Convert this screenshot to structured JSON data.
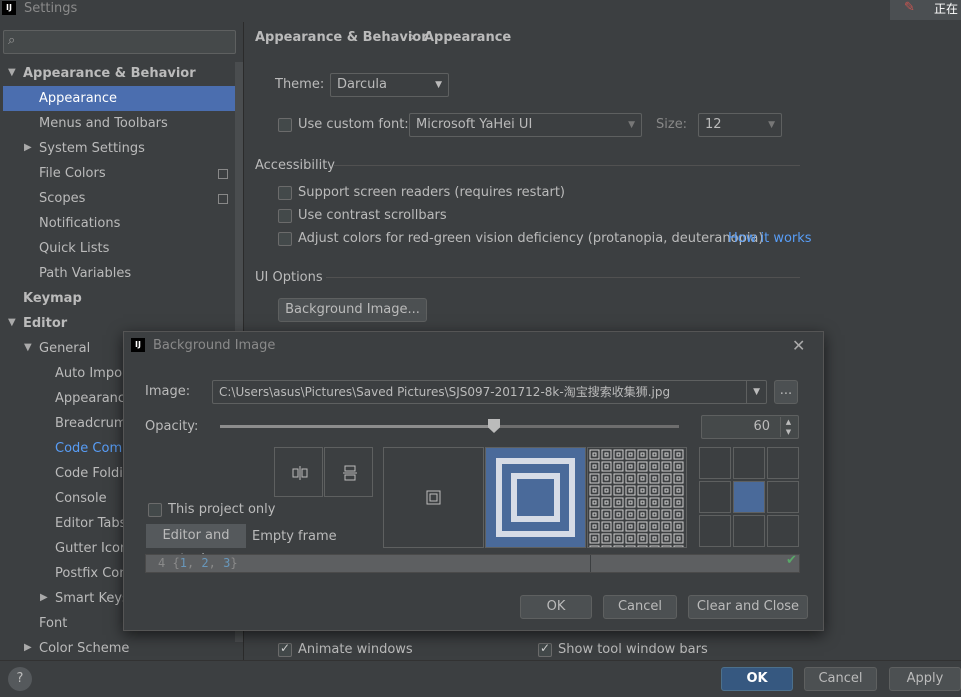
{
  "window": {
    "title": "Settings",
    "notification_text": "正在"
  },
  "sidebar": {
    "search_placeholder": "",
    "items": [
      {
        "label": "Appearance & Behavior"
      },
      {
        "label": "Appearance"
      },
      {
        "label": "Menus and Toolbars"
      },
      {
        "label": "System Settings"
      },
      {
        "label": "File Colors"
      },
      {
        "label": "Scopes"
      },
      {
        "label": "Notifications"
      },
      {
        "label": "Quick Lists"
      },
      {
        "label": "Path Variables"
      },
      {
        "label": "Keymap"
      },
      {
        "label": "Editor"
      },
      {
        "label": "General"
      },
      {
        "label": "Auto Impor"
      },
      {
        "label": "Appearanc"
      },
      {
        "label": "Breadcrumb"
      },
      {
        "label": "Code Comp"
      },
      {
        "label": "Code Foldin"
      },
      {
        "label": "Console"
      },
      {
        "label": "Editor Tabs"
      },
      {
        "label": "Gutter Icons"
      },
      {
        "label": "Postfix Com"
      },
      {
        "label": "Smart Keys"
      },
      {
        "label": "Font"
      },
      {
        "label": "Color Scheme"
      }
    ]
  },
  "breadcrumb": {
    "parent": "Appearance & Behavior",
    "separator": "›",
    "current": "Appearance"
  },
  "appearance": {
    "theme_label": "Theme:",
    "theme_value": "Darcula",
    "custom_font_label": "Use custom font:",
    "custom_font_value": "Microsoft YaHei UI",
    "size_label": "Size:",
    "size_value": "12",
    "accessibility_header": "Accessibility",
    "screen_readers": "Support screen readers (requires restart)",
    "contrast_scrollbars": "Use contrast scrollbars",
    "adjust_colors": "Adjust colors for red-green vision deficiency (protanopia, deuteranopia)",
    "how_it_works": "How it works",
    "ui_options_header": "UI Options",
    "background_image_button": "Background Image...",
    "animate_windows": "Animate windows",
    "show_tool_window_bars": "Show tool window bars"
  },
  "dialog": {
    "title": "Background Image",
    "image_label": "Image:",
    "image_path": "C:\\Users\\asus\\Pictures\\Saved Pictures\\SJS097-201712-8k-淘宝搜索收集狮.jpg",
    "browse_label": "...",
    "opacity_label": "Opacity:",
    "opacity_value": "60",
    "opacity_fraction": 0.6,
    "this_project_only": "This project only",
    "tab_editor_tools": "Editor and tools",
    "tab_empty_frame": "Empty frame",
    "code_line_no": "4",
    "code_open": "{",
    "code_n1": "1",
    "code_n2": "2",
    "code_n3": "3",
    "code_close": "}",
    "code_comma": ", ",
    "ok": "OK",
    "cancel": "Cancel",
    "clear_and_close": "Clear and Close"
  },
  "footer": {
    "help": "?",
    "ok": "OK",
    "cancel": "Cancel",
    "apply": "Apply"
  },
  "colors": {
    "selection": "#4b6eaf",
    "link": "#589df6",
    "accent_blue": "#365880",
    "preview_fill": "#4a6a9a",
    "check_green": "#59a869"
  }
}
